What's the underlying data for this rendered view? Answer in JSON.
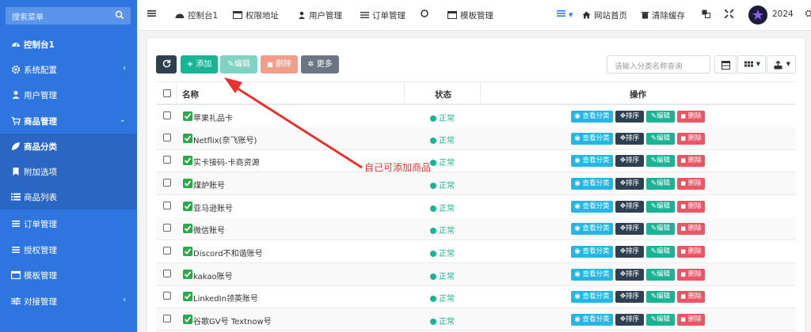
{
  "sidebar": {
    "search_placeholder": "搜索菜单",
    "items": [
      {
        "label": "控制台1",
        "icon": "dashboard-icon"
      },
      {
        "label": "系统配置",
        "icon": "gear-icon"
      },
      {
        "label": "用户管理",
        "icon": "user-icon"
      },
      {
        "label": "商品管理",
        "icon": "cart-icon"
      },
      {
        "label": "商品分类",
        "icon": "leaf-icon"
      },
      {
        "label": "附加选项",
        "icon": "bookmark-icon"
      },
      {
        "label": "商品列表",
        "icon": "list-icon"
      },
      {
        "label": "订单管理",
        "icon": "list-icon"
      },
      {
        "label": "授权管理",
        "icon": "list-icon"
      },
      {
        "label": "模板管理",
        "icon": "window-icon"
      },
      {
        "label": "对接管理",
        "icon": "sliders-icon"
      }
    ]
  },
  "topbar": {
    "tabs": [
      {
        "label": "控制台1",
        "icon": "dashboard-icon"
      },
      {
        "label": "权限地址",
        "icon": "window-icon"
      },
      {
        "label": "用户管理",
        "icon": "user-icon"
      },
      {
        "label": "订单管理",
        "icon": "list-icon"
      },
      {
        "label": "",
        "icon": "circle-icon"
      },
      {
        "label": "模板管理",
        "icon": "window-icon"
      }
    ],
    "home_label": "网站首页",
    "clear_cache_label": "清除缓存",
    "year_label": "2024"
  },
  "toolbar": {
    "add_label": "添加",
    "edit_label": "编辑",
    "delete_label": "删除",
    "more_label": "更多",
    "search_placeholder": "请输入分类名称查询"
  },
  "table": {
    "headers": {
      "name": "名称",
      "status": "状态",
      "actions": "操作"
    },
    "status_text": "正常",
    "action_labels": {
      "view": "查看分类",
      "sort": "排序",
      "edit": "编辑",
      "delete": "删除"
    },
    "rows": [
      {
        "name": "苹果礼品卡"
      },
      {
        "name": "Netflix(奈飞账号)"
      },
      {
        "name": "实卡接码-卡商资源"
      },
      {
        "name": "煤炉账号"
      },
      {
        "name": "亚马逊账号"
      },
      {
        "name": "微信账号"
      },
      {
        "name": "Discord不和谐账号"
      },
      {
        "name": "kakao账号"
      },
      {
        "name": "LinkedIn领英账号"
      },
      {
        "name": "谷歌GV号 Textnow号"
      }
    ]
  },
  "annotation": {
    "text": "自己可添加商品",
    "color": "#e8312f"
  },
  "colors": {
    "sidebar": "#2f75e0",
    "primary": "#1ab394",
    "danger": "#ed5565",
    "info": "#23b7e5",
    "dark": "#2f4050"
  }
}
